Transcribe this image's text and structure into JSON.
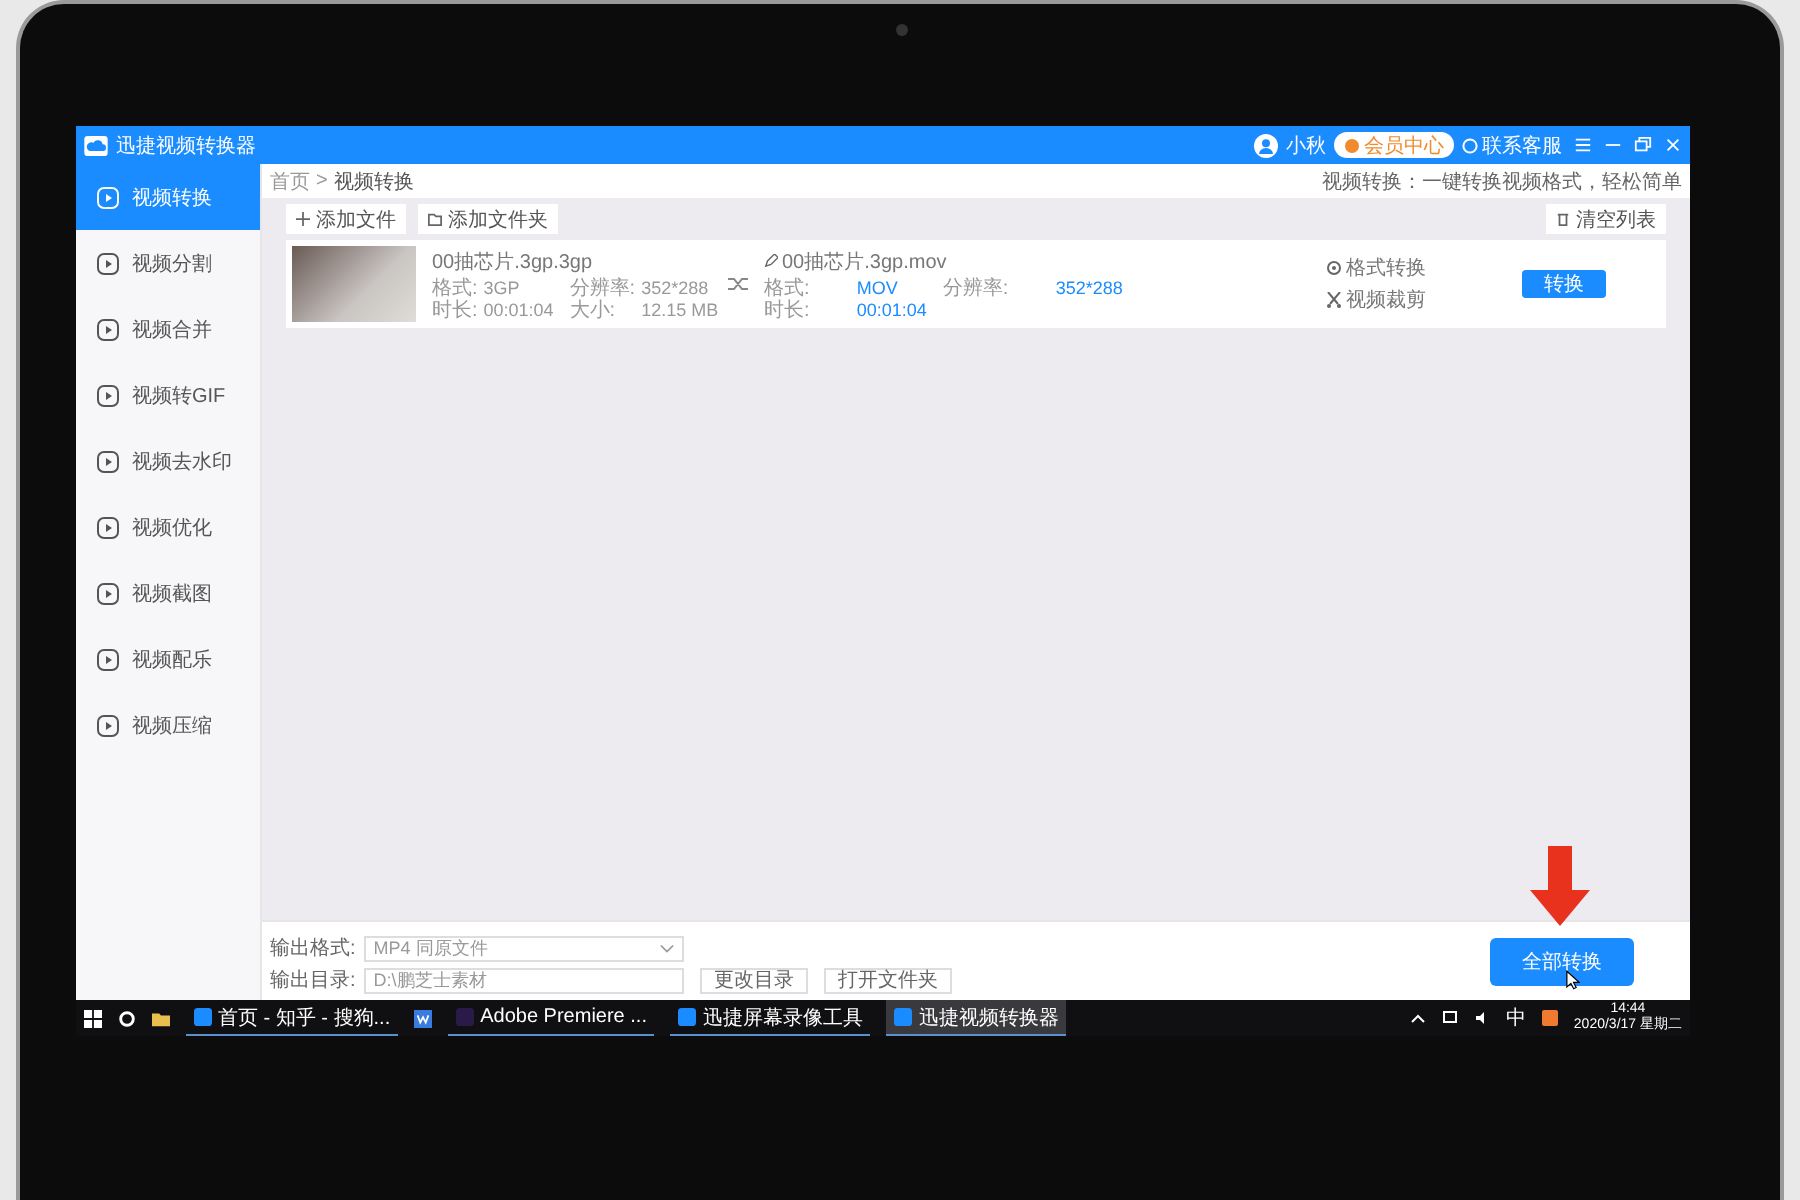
{
  "window": {
    "title": "迅捷视频转换器"
  },
  "user": {
    "name": "小秋"
  },
  "vip_button": "会员中心",
  "support": "联系客服",
  "sidebar": {
    "items": [
      {
        "label": "视频转换",
        "selected": true
      },
      {
        "label": "视频分割",
        "selected": false
      },
      {
        "label": "视频合并",
        "selected": false
      },
      {
        "label": "视频转GIF",
        "selected": false
      },
      {
        "label": "视频去水印",
        "selected": false
      },
      {
        "label": "视频优化",
        "selected": false
      },
      {
        "label": "视频截图",
        "selected": false
      },
      {
        "label": "视频配乐",
        "selected": false
      },
      {
        "label": "视频压缩",
        "selected": false
      }
    ]
  },
  "breadcrumb": {
    "items": [
      "首页",
      "视频转换"
    ],
    "separator": ">"
  },
  "tagline": "视频转换：一键转换视频格式，轻松简单",
  "toolbar": {
    "add_file": "添加文件",
    "add_folder": "添加文件夹",
    "clear_list": "清空列表"
  },
  "files": [
    {
      "name": "00抽芯片.3gp.3gp",
      "format_label": "格式:",
      "format": "3GP",
      "resolution_label": "分辨率:",
      "resolution": "352*288",
      "duration_label": "时长:",
      "duration": "00:01:04",
      "size_label": "大小:",
      "size": "12.15 MB",
      "output": {
        "name": "00抽芯片.3gp.mov",
        "format_label": "格式:",
        "format": "MOV",
        "resolution_label": "分辨率:",
        "resolution": "352*288",
        "duration_label": "时长:",
        "duration": "00:01:04"
      },
      "actions": [
        "格式转换",
        "视频裁剪"
      ],
      "convert_button": "转换"
    }
  ],
  "output_settings": {
    "format_label": "输出格式:",
    "format_value": "MP4  同原文件",
    "dir_label": "输出目录:",
    "dir_value": "D:\\鹏芝士素材",
    "change_dir": "更改目录",
    "open_folder": "打开文件夹"
  },
  "convert_all": "全部转换",
  "taskbar": {
    "apps": [
      {
        "label": "首页 - 知乎 - 搜狗...",
        "selected": false
      },
      {
        "label": "Adobe Premiere ...",
        "selected": false
      },
      {
        "label": "迅捷屏幕录像工具",
        "selected": false
      },
      {
        "label": "迅捷视频转换器",
        "selected": true
      }
    ],
    "ime": "中",
    "time": "14:44",
    "date": "2020/3/17 星期二"
  }
}
